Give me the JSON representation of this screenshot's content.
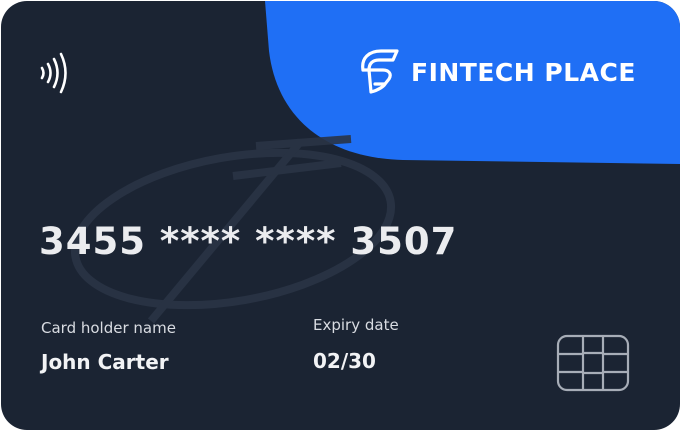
{
  "brand": {
    "name": "FINTECH PLACE",
    "logo_icon": "fintech-place-logo-icon"
  },
  "card": {
    "number": "3455 **** **** 3507",
    "holder_label": "Card holder name",
    "holder_name": "John Carter",
    "expiry_label": "Expiry date",
    "expiry_value": "02/30"
  },
  "icons": {
    "contactless": "contactless-icon",
    "chip": "chip-icon"
  },
  "colors": {
    "card_background": "#1b2433",
    "accent": "#1f6ff5",
    "text": "#ffffff"
  }
}
